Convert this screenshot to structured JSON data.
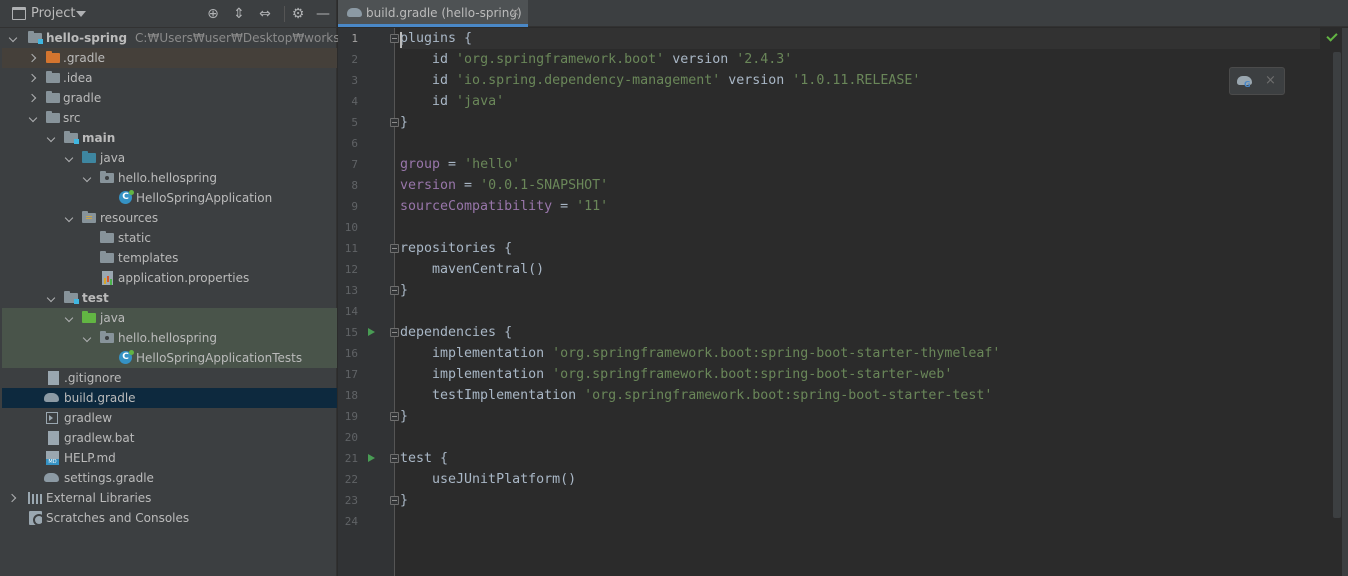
{
  "project_panel": {
    "title": "Project",
    "toolbar": {
      "locate": "⊕",
      "expand_all": "⇕",
      "collapse_all": "⇔",
      "settings": "⚙",
      "hide": "—"
    },
    "tree": [
      {
        "label": "hello-spring",
        "hint": "C:₩Users₩user₩Desktop₩workspace₩sp"
      },
      {
        "label": ".gradle"
      },
      {
        "label": ".idea"
      },
      {
        "label": "gradle"
      },
      {
        "label": "src"
      },
      {
        "label": "main"
      },
      {
        "label": "java"
      },
      {
        "label": "hello.hellospring"
      },
      {
        "label": "HelloSpringApplication"
      },
      {
        "label": "resources"
      },
      {
        "label": "static"
      },
      {
        "label": "templates"
      },
      {
        "label": "application.properties"
      },
      {
        "label": "test"
      },
      {
        "label": "java"
      },
      {
        "label": "hello.hellospring"
      },
      {
        "label": "HelloSpringApplicationTests"
      },
      {
        "label": ".gitignore"
      },
      {
        "label": "build.gradle"
      },
      {
        "label": "gradlew"
      },
      {
        "label": "gradlew.bat"
      },
      {
        "label": "HELP.md"
      },
      {
        "label": "settings.gradle"
      },
      {
        "label": "External Libraries"
      },
      {
        "label": "Scratches and Consoles"
      }
    ]
  },
  "editor": {
    "tab": {
      "title": "build.gradle (hello-spring)",
      "close": "×"
    },
    "popup_close": "×",
    "line_numbers": [
      "1",
      "2",
      "3",
      "4",
      "5",
      "6",
      "7",
      "8",
      "9",
      "10",
      "11",
      "12",
      "13",
      "14",
      "15",
      "16",
      "17",
      "18",
      "19",
      "20",
      "21",
      "22",
      "23",
      "24"
    ],
    "code": [
      [
        {
          "t": "plugins {"
        }
      ],
      [
        {
          "t": "    id "
        },
        {
          "t": "'org.springframework.boot'",
          "c": "str"
        },
        {
          "t": " version "
        },
        {
          "t": "'2.4.3'",
          "c": "str"
        }
      ],
      [
        {
          "t": "    id "
        },
        {
          "t": "'io.spring.dependency-management'",
          "c": "str"
        },
        {
          "t": " version "
        },
        {
          "t": "'1.0.11.RELEASE'",
          "c": "str"
        }
      ],
      [
        {
          "t": "    id "
        },
        {
          "t": "'java'",
          "c": "str"
        }
      ],
      [
        {
          "t": "}"
        }
      ],
      [],
      [
        {
          "t": "group",
          "c": "prop"
        },
        {
          "t": " = "
        },
        {
          "t": "'hello'",
          "c": "str"
        }
      ],
      [
        {
          "t": "version",
          "c": "prop"
        },
        {
          "t": " = "
        },
        {
          "t": "'0.0.1-SNAPSHOT'",
          "c": "str"
        }
      ],
      [
        {
          "t": "sourceCompatibility",
          "c": "prop"
        },
        {
          "t": " = "
        },
        {
          "t": "'11'",
          "c": "str"
        }
      ],
      [],
      [
        {
          "t": "repositories {"
        }
      ],
      [
        {
          "t": "    mavenCentral()"
        }
      ],
      [
        {
          "t": "}"
        }
      ],
      [],
      [
        {
          "t": "dependencies {"
        }
      ],
      [
        {
          "t": "    implementation "
        },
        {
          "t": "'org.springframework.boot:spring-boot-starter-thymeleaf'",
          "c": "str"
        }
      ],
      [
        {
          "t": "    implementation "
        },
        {
          "t": "'org.springframework.boot:spring-boot-starter-web'",
          "c": "str"
        }
      ],
      [
        {
          "t": "    testImplementation "
        },
        {
          "t": "'org.springframework.boot:spring-boot-starter-test'",
          "c": "str"
        }
      ],
      [
        {
          "t": "}"
        }
      ],
      [],
      [
        {
          "t": "test {"
        }
      ],
      [
        {
          "t": "    useJUnitPlatform()"
        }
      ],
      [
        {
          "t": "}"
        }
      ],
      []
    ]
  }
}
